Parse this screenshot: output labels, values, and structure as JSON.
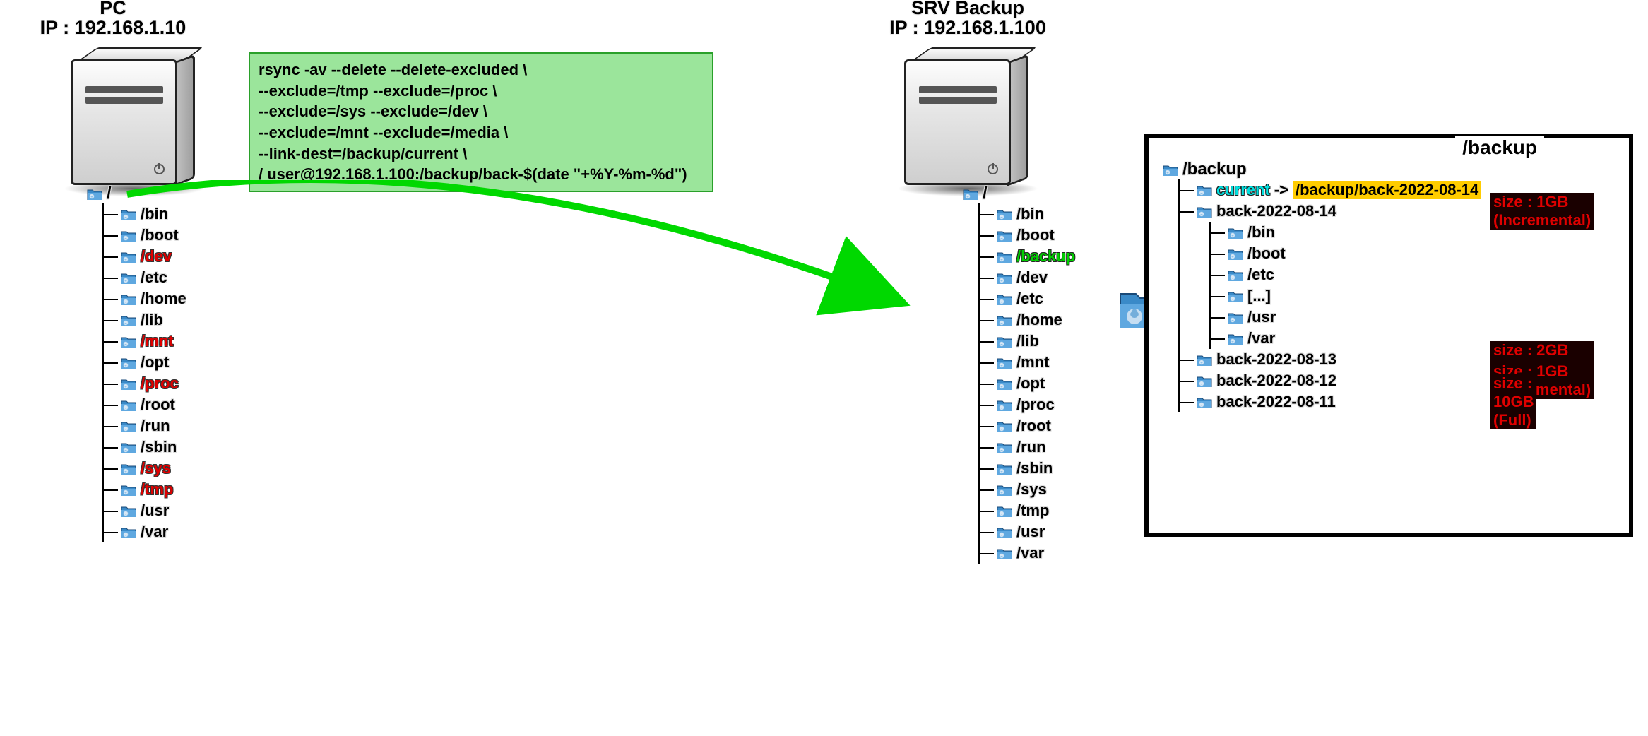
{
  "pc": {
    "title1": "PC",
    "title2": "IP : 192.168.1.10",
    "root": "/",
    "dirs": [
      {
        "name": "/bin",
        "ex": false
      },
      {
        "name": "/boot",
        "ex": false
      },
      {
        "name": "/dev",
        "ex": true
      },
      {
        "name": "/etc",
        "ex": false
      },
      {
        "name": "/home",
        "ex": false
      },
      {
        "name": "/lib",
        "ex": false
      },
      {
        "name": "/mnt",
        "ex": true
      },
      {
        "name": "/opt",
        "ex": false
      },
      {
        "name": "/proc",
        "ex": true
      },
      {
        "name": "/root",
        "ex": false
      },
      {
        "name": "/run",
        "ex": false
      },
      {
        "name": "/sbin",
        "ex": false
      },
      {
        "name": "/sys",
        "ex": true
      },
      {
        "name": "/tmp",
        "ex": true
      },
      {
        "name": "/usr",
        "ex": false
      },
      {
        "name": "/var",
        "ex": false
      }
    ]
  },
  "srv": {
    "title1": "SRV Backup",
    "title2": "IP : 192.168.1.100",
    "root": "/",
    "dirs": [
      {
        "name": "/bin",
        "hl": false
      },
      {
        "name": "/boot",
        "hl": false
      },
      {
        "name": "/backup",
        "hl": true
      },
      {
        "name": "/dev",
        "hl": false
      },
      {
        "name": "/etc",
        "hl": false
      },
      {
        "name": "/home",
        "hl": false
      },
      {
        "name": "/lib",
        "hl": false
      },
      {
        "name": "/mnt",
        "hl": false
      },
      {
        "name": "/opt",
        "hl": false
      },
      {
        "name": "/proc",
        "hl": false
      },
      {
        "name": "/root",
        "hl": false
      },
      {
        "name": "/run",
        "hl": false
      },
      {
        "name": "/sbin",
        "hl": false
      },
      {
        "name": "/sys",
        "hl": false
      },
      {
        "name": "/tmp",
        "hl": false
      },
      {
        "name": "/usr",
        "hl": false
      },
      {
        "name": "/var",
        "hl": false
      }
    ]
  },
  "command": "rsync -av --delete --delete-excluded \\\n--exclude=/tmp --exclude=/proc \\\n--exclude=/sys --exclude=/dev \\\n--exclude=/mnt --exclude=/media \\\n--link-dest=/backup/current \\\n/ user@192.168.1.100:/backup/back-$(date \"+%Y-%m-%d\")",
  "panel": {
    "title": "/backup",
    "root": "/backup",
    "current_label": "current",
    "current_arrow": "->",
    "current_target": "/backup/back-2022-08-14",
    "latest": {
      "name": "back-2022-08-14",
      "badge": "size : 1GB (Incremental)",
      "children": [
        "/bin",
        "/boot",
        "/etc",
        "[...]",
        "/usr",
        "/var"
      ]
    },
    "others": [
      {
        "name": "back-2022-08-13",
        "badge": "size : 2GB (Incremental)"
      },
      {
        "name": "back-2022-08-12",
        "badge": "size : 1GB (Incremental)"
      },
      {
        "name": "back-2022-08-11",
        "badge": "size : 10GB (Full)"
      }
    ]
  }
}
